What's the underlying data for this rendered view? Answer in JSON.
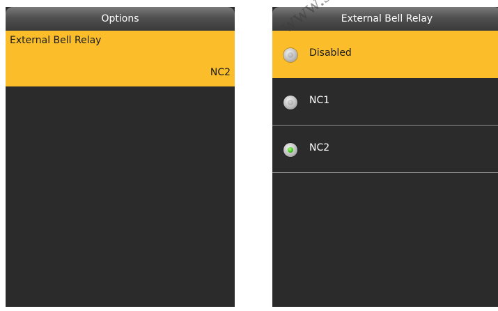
{
  "left_screen": {
    "title": "Options",
    "option": {
      "label": "External Bell Relay",
      "value": "NC2"
    }
  },
  "right_screen": {
    "title": "External Bell Relay",
    "options": [
      {
        "label": "Disabled",
        "selected": false,
        "highlighted": true
      },
      {
        "label": "NC1",
        "selected": false,
        "highlighted": false
      },
      {
        "label": "NC2",
        "selected": true,
        "highlighted": false
      }
    ]
  },
  "watermark": "www.se",
  "colors": {
    "background": "#2b2b2b",
    "highlight": "#fbbd2a",
    "radio_on": "#39c21a",
    "title_bar": "#505050"
  }
}
